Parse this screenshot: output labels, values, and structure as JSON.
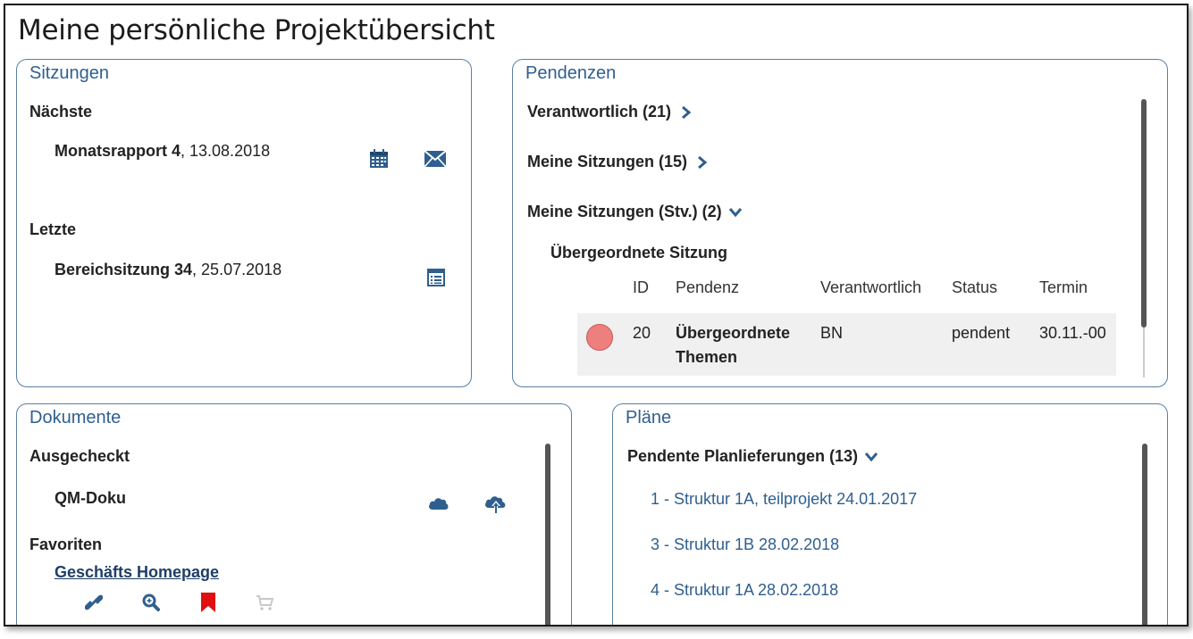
{
  "page": {
    "title": "Meine persönliche Projektübersicht"
  },
  "sitzungen": {
    "title": "Sitzungen",
    "next_label": "Nächste",
    "next_item": {
      "name": "Monatsrapport 4",
      "date": ", 13.08.2018"
    },
    "last_label": "Letzte",
    "last_item": {
      "name": "Bereichsitzung 34",
      "date": ", 25.07.2018"
    },
    "icons": [
      "calendar-icon",
      "envelope-icon",
      "list-icon"
    ]
  },
  "pendenzen": {
    "title": "Pendenzen",
    "groups": [
      {
        "label": "Verantwortlich (21)",
        "state": "collapsed"
      },
      {
        "label": "Meine Sitzungen (15)",
        "state": "collapsed"
      },
      {
        "label": "Meine Sitzungen (Stv.) (2)",
        "state": "expanded"
      }
    ],
    "subgroup": "Übergeordnete Sitzung",
    "table": {
      "headers": [
        "ID",
        "Pendenz",
        "Verantwortlich",
        "Status",
        "Termin"
      ],
      "rows": [
        {
          "id": "20",
          "pendenz_line1": "Übergeordnete",
          "pendenz_line2": "Themen",
          "verantwortlich": "BN",
          "status": "pendent",
          "termin": "30.11.-00",
          "status_color": "#ee7f7f"
        }
      ]
    }
  },
  "dokumente": {
    "title": "Dokumente",
    "checked_out_label": "Ausgecheckt",
    "checked_out_item": "QM-Doku",
    "favorites_label": "Favoriten",
    "favorite_link": "Geschäfts Homepage",
    "icons": [
      "cloud-icon",
      "cloud-upload-icon",
      "link-icon",
      "search-icon",
      "bookmark-icon",
      "cart-icon"
    ]
  },
  "plaene": {
    "title": "Pläne",
    "group_label": "Pendente Planlieferungen (13)",
    "items": [
      "1 - Struktur 1A, teilprojekt 24.01.2017",
      "3 - Struktur 1B 28.02.2018",
      "4 - Struktur 1A 28.02.2018"
    ]
  },
  "colors": {
    "accent": "#2f5f8f",
    "border": "#5a7fa3",
    "status_red": "#ee7f7f",
    "bookmark_red": "#e01010"
  }
}
